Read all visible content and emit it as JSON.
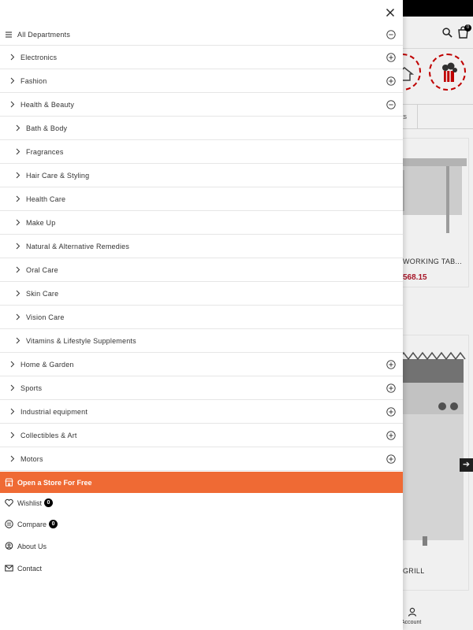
{
  "background_page": {
    "cart_count": "0",
    "tab_fragment": "ts",
    "products": [
      {
        "name_fragment": "WORKING TAB...",
        "price_fragment": "568.15"
      },
      {
        "name_fragment": "GRILL"
      }
    ],
    "account_label": "Account",
    "colors": {
      "price": "#b2182b",
      "topbar": "#000000"
    }
  },
  "drawer": {
    "header": {
      "label": "All Departments",
      "icon": "hamburger-icon",
      "toggle": "minus-circle-icon"
    },
    "departments": [
      {
        "label": "Electronics",
        "level": 0,
        "toggle": "plus"
      },
      {
        "label": "Fashion",
        "level": 0,
        "toggle": "plus"
      },
      {
        "label": "Health & Beauty",
        "level": 0,
        "toggle": "minus"
      },
      {
        "label": "Bath & Body",
        "level": 1
      },
      {
        "label": "Fragrances",
        "level": 1
      },
      {
        "label": "Hair Care & Styling",
        "level": 1
      },
      {
        "label": "Health Care",
        "level": 1
      },
      {
        "label": "Make Up",
        "level": 1
      },
      {
        "label": "Natural & Alternative Remedies",
        "level": 1
      },
      {
        "label": "Oral Care",
        "level": 1
      },
      {
        "label": "Skin Care",
        "level": 1
      },
      {
        "label": "Vision Care",
        "level": 1
      },
      {
        "label": "Vitamins & Lifestyle Supplements",
        "level": 1
      },
      {
        "label": "Home & Garden",
        "level": 0,
        "toggle": "plus"
      },
      {
        "label": "Sports",
        "level": 0,
        "toggle": "plus"
      },
      {
        "label": "Industrial equipment",
        "level": 0,
        "toggle": "plus"
      },
      {
        "label": "Collectibles & Art",
        "level": 0,
        "toggle": "plus"
      },
      {
        "label": "Motors",
        "level": 0,
        "toggle": "plus"
      }
    ],
    "store_banner": {
      "label": "Open a Store For Free",
      "color": "#ef6a34",
      "icon": "store-icon"
    },
    "links": {
      "wishlist": {
        "label": "Wishlist",
        "count": "0",
        "icon": "heart-icon"
      },
      "compare": {
        "label": "Compare",
        "count": "0",
        "icon": "compare-icon"
      },
      "about": {
        "label": "About Us",
        "icon": "about-icon"
      },
      "contact": {
        "label": "Contact",
        "icon": "mail-icon"
      }
    }
  }
}
